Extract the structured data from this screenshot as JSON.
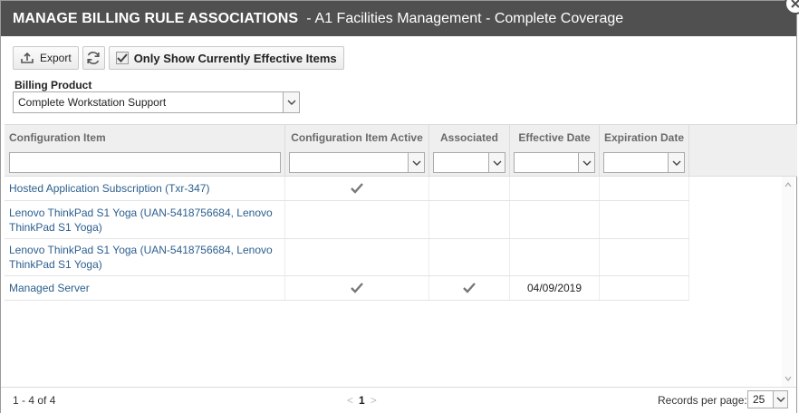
{
  "dialog": {
    "title": "MANAGE BILLING RULE ASSOCIATIONS",
    "title_separator": "-",
    "subtitle": "A1 Facilities Management - Complete Coverage"
  },
  "toolbar": {
    "export_label": "Export",
    "refresh_icon": "refresh-icon",
    "effective_filter_label": "Only Show Currently Effective Items",
    "effective_filter_checked": true
  },
  "billing_product": {
    "label": "Billing Product",
    "value": "Complete Workstation Support"
  },
  "grid": {
    "columns": [
      "Configuration Item",
      "Configuration Item Active",
      "Associated",
      "Effective Date",
      "Expiration Date"
    ],
    "filters": {
      "configuration_item": "",
      "active": "",
      "associated": "",
      "effective_date": "",
      "expiration_date": ""
    },
    "rows": [
      {
        "item": "Hosted Application Subscription (Txr-347)",
        "active": true,
        "associated": false,
        "effective_date": "",
        "expiration_date": ""
      },
      {
        "item": "Lenovo ThinkPad S1 Yoga (UAN-5418756684, Lenovo ThinkPad S1 Yoga)",
        "active": false,
        "associated": false,
        "effective_date": "",
        "expiration_date": ""
      },
      {
        "item": "Lenovo ThinkPad S1 Yoga (UAN-5418756684, Lenovo ThinkPad S1 Yoga)",
        "active": false,
        "associated": false,
        "effective_date": "",
        "expiration_date": ""
      },
      {
        "item": "Managed Server",
        "active": true,
        "associated": true,
        "effective_date": "04/09/2019",
        "expiration_date": ""
      }
    ]
  },
  "footer": {
    "range": "1 - 4 of 4",
    "prev": "<",
    "page": "1",
    "next": ">",
    "records_label": "Records per page:",
    "records_value": "25"
  },
  "colors": {
    "titlebar": "#505050",
    "link": "#2c5f8e",
    "header_bg": "#efefef"
  }
}
